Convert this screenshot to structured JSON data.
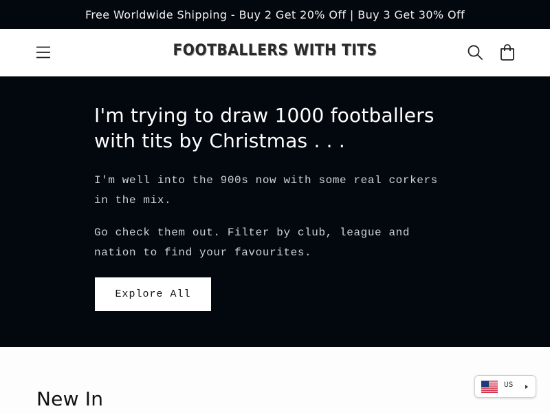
{
  "announcement": {
    "text": "Free Worldwide Shipping - Buy 2 Get 20% Off | Buy 3 Get 30% Off"
  },
  "header": {
    "logo_text": "FOOTBALLERS WITH TITS",
    "menu_icon": "hamburger-menu-icon",
    "search_icon": "search-icon",
    "cart_icon": "shopping-bag-icon"
  },
  "hero": {
    "title": "I'm trying to draw 1000 footballers with tits by Christmas . . .",
    "paragraph_1": "I'm well into the 900s now with some real corkers in the mix.",
    "paragraph_2": "Go check them out. Filter by club, league and nation to find your favourites.",
    "cta_label": "Explore All"
  },
  "new_in": {
    "title": "New In"
  },
  "country_selector": {
    "code": "US",
    "flag_icon": "us-flag-icon",
    "arrow_icon": "chevron-right-icon"
  },
  "colors": {
    "dark_background": "#03080f",
    "light_background": "#fdfdfd",
    "button_background": "#ffffff"
  }
}
